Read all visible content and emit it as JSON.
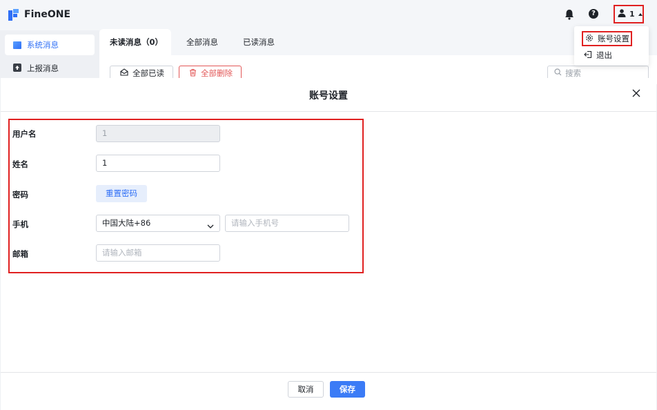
{
  "app": {
    "name": "FineONE"
  },
  "header": {
    "user_label": "1",
    "menu": {
      "settings_label": "账号设置",
      "logout_label": "退出"
    }
  },
  "sidebar": {
    "items": [
      {
        "label": "系统消息",
        "active": true
      },
      {
        "label": "上报消息",
        "active": false
      }
    ]
  },
  "tabs": [
    {
      "label": "未读消息（0）"
    },
    {
      "label": "全部消息"
    },
    {
      "label": "已读消息"
    }
  ],
  "toolbar": {
    "mark_read_label": "全部已读",
    "delete_all_label": "全部删除",
    "search_placeholder": "搜索"
  },
  "modal": {
    "title": "账号设置",
    "fields": {
      "username_label": "用户名",
      "username_value": "1",
      "name_label": "姓名",
      "name_value": "1",
      "password_label": "密码",
      "reset_password_label": "重置密码",
      "phone_label": "手机",
      "country_code": "中国大陆+86",
      "phone_placeholder": "请输入手机号",
      "email_label": "邮箱",
      "email_placeholder": "请输入邮箱"
    },
    "cancel_label": "取消",
    "save_label": "保存"
  },
  "colors": {
    "accent": "#2f6ff6",
    "danger": "#e25656",
    "highlight_border": "#e02020"
  },
  "icons": [
    "logo-icon",
    "bell-icon",
    "help-icon",
    "user-icon",
    "caret-up-icon",
    "gear-icon",
    "logout-icon",
    "message-icon",
    "upload-icon",
    "envelope-open-icon",
    "trash-icon",
    "search-icon",
    "close-icon",
    "chevron-down-icon"
  ]
}
